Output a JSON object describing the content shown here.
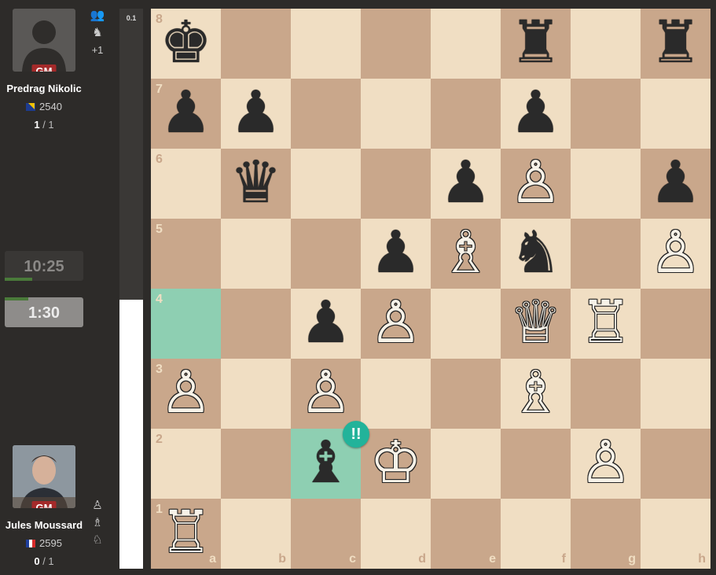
{
  "top_player": {
    "title": "GM",
    "name": "Predrag Nikolic",
    "rating": "2540",
    "score_own": "1",
    "score_rest": " / 1",
    "icons_extra": "+1"
  },
  "bottom_player": {
    "title": "GM",
    "name": "Jules Moussard",
    "rating": "2595",
    "score_own": "0",
    "score_rest": " / 1"
  },
  "clocks": {
    "top": "10:25",
    "bottom": "1:30",
    "top_fraction": 0.35,
    "bottom_fraction": 0.3
  },
  "evaluation": {
    "label": "0.1",
    "white_fraction": 0.48
  },
  "annotation": {
    "symbol": "!!",
    "square": "c2"
  },
  "highlights": [
    "a4",
    "c2"
  ],
  "files": [
    "a",
    "b",
    "c",
    "d",
    "e",
    "f",
    "g",
    "h"
  ],
  "ranks": [
    "8",
    "7",
    "6",
    "5",
    "4",
    "3",
    "2",
    "1"
  ],
  "pieces": [
    {
      "sq": "a8",
      "p": "k",
      "c": "b"
    },
    {
      "sq": "f8",
      "p": "r",
      "c": "b"
    },
    {
      "sq": "h8",
      "p": "r",
      "c": "b"
    },
    {
      "sq": "a7",
      "p": "p",
      "c": "b"
    },
    {
      "sq": "b7",
      "p": "p",
      "c": "b"
    },
    {
      "sq": "f7",
      "p": "p",
      "c": "b"
    },
    {
      "sq": "b6",
      "p": "q",
      "c": "b"
    },
    {
      "sq": "e6",
      "p": "p",
      "c": "b"
    },
    {
      "sq": "f6",
      "p": "p",
      "c": "w"
    },
    {
      "sq": "h6",
      "p": "p",
      "c": "b"
    },
    {
      "sq": "d5",
      "p": "p",
      "c": "b"
    },
    {
      "sq": "e5",
      "p": "b",
      "c": "w"
    },
    {
      "sq": "f5",
      "p": "n",
      "c": "b"
    },
    {
      "sq": "h5",
      "p": "p",
      "c": "w"
    },
    {
      "sq": "c4",
      "p": "p",
      "c": "b"
    },
    {
      "sq": "d4",
      "p": "p",
      "c": "w"
    },
    {
      "sq": "f4",
      "p": "q",
      "c": "w"
    },
    {
      "sq": "g4",
      "p": "r",
      "c": "w"
    },
    {
      "sq": "a3",
      "p": "p",
      "c": "w"
    },
    {
      "sq": "c3",
      "p": "p",
      "c": "w"
    },
    {
      "sq": "f3",
      "p": "b",
      "c": "w"
    },
    {
      "sq": "c2",
      "p": "b",
      "c": "b"
    },
    {
      "sq": "d2",
      "p": "k",
      "c": "w"
    },
    {
      "sq": "g2",
      "p": "p",
      "c": "w"
    },
    {
      "sq": "a1",
      "p": "r",
      "c": "w"
    }
  ]
}
